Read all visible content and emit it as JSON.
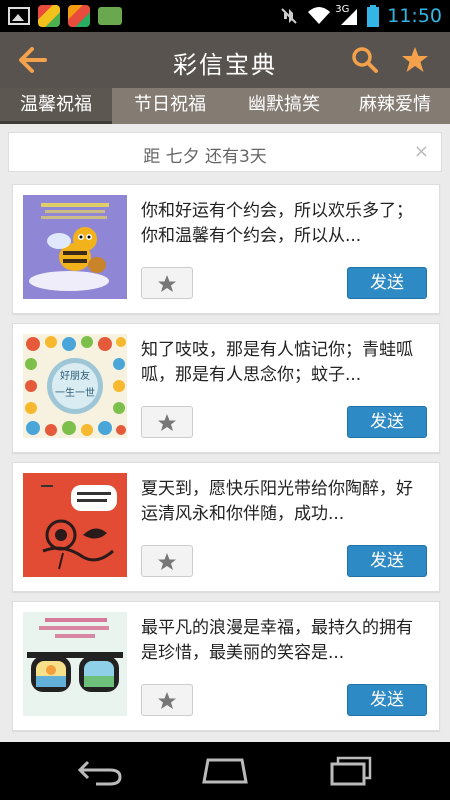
{
  "status_bar": {
    "time": "11:50",
    "network_label": "3G",
    "icons": [
      "image-icon",
      "app-icon",
      "app-icon",
      "message-icon",
      "mute-icon",
      "wifi-icon",
      "signal-icon",
      "battery-icon"
    ]
  },
  "action_bar": {
    "title": "彩信宝典",
    "icons": [
      "back-arrow-icon",
      "search-icon",
      "star-icon"
    ]
  },
  "tabs": [
    {
      "label": "温馨祝福",
      "active": true
    },
    {
      "label": "节日祝福",
      "active": false
    },
    {
      "label": "幽默搞笑",
      "active": false
    },
    {
      "label": "麻辣爱情",
      "active": false
    }
  ],
  "notice": {
    "text": "距 七夕 还有3天",
    "close_label": "×"
  },
  "cards": [
    {
      "text": "你和好运有个约会，所以欢乐多了；你和温馨有个约会，所以从...",
      "thumb_caption": "",
      "send_label": "发送"
    },
    {
      "text": "知了吱吱，那是有人惦记你；青蛙呱呱，那是有人思念你；蚊子...",
      "thumb_caption": "好朋友\n一生一世",
      "send_label": "发送"
    },
    {
      "text": "夏天到，愿快乐阳光带给你陶醉，好运清风永和你伴随，成功...",
      "thumb_caption": "",
      "send_label": "发送"
    },
    {
      "text": "最平凡的浪漫是幸福，最持久的拥有是珍惜，最美丽的笑容是...",
      "thumb_caption": "",
      "send_label": "发送"
    }
  ],
  "colors": {
    "action_bar": "#58534f",
    "tab_bar": "#847b73",
    "tab_active": "#5d5751",
    "accent_orange": "#f3a14b",
    "send_button": "#2e8ac4",
    "time": "#33b5e5"
  },
  "nav_bar": {
    "icons": [
      "back-nav-icon",
      "home-nav-icon",
      "recents-nav-icon"
    ]
  }
}
